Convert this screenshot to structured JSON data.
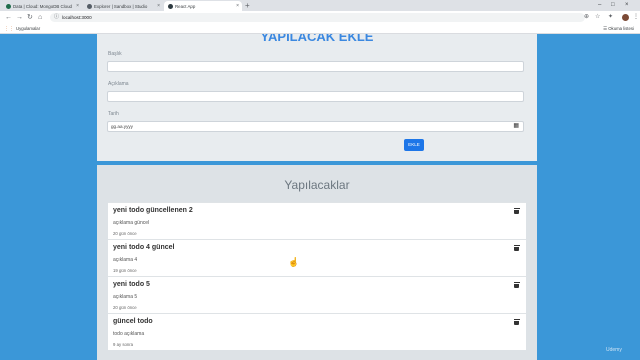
{
  "browser": {
    "tabs": [
      {
        "title": "Data | Cloud: MongoDB Cloud",
        "favicon_color": "#1e6b4a"
      },
      {
        "title": "Explorer | Sandbox | Studio",
        "favicon_color": "#555d66"
      },
      {
        "title": "React App",
        "favicon_color": "#2d3a40"
      }
    ],
    "url": "localhost:3000",
    "bookmarks": {
      "apps_label": "Uygulamalar",
      "reading_list_label": "Okuma listesi"
    }
  },
  "add_form": {
    "title": "YAPILACAK EKLE",
    "title_label": "Başlık",
    "title_value": "",
    "description_label": "Açıklama",
    "description_value": "",
    "date_label": "Tarih",
    "date_placeholder": "gg.aa.yyyy",
    "submit_label": "EKLE"
  },
  "todo_list": {
    "title": "Yapılacaklar",
    "items": [
      {
        "title": "yeni todo güncellenen 2",
        "description": "açıklama güncel",
        "date": "20 gün önce"
      },
      {
        "title": "yeni todo 4 güncel",
        "description": "açıklama 4",
        "date": "19 gün önce"
      },
      {
        "title": "yeni todo 5",
        "description": "açıklama 5",
        "date": "20 gün önce"
      },
      {
        "title": "güncel todo",
        "description": "todo açıklama",
        "date": "9 ay sonra"
      }
    ]
  },
  "watermark": "Udemy",
  "colors": {
    "page_bg": "#3b97d8",
    "accent": "#1d76e8",
    "title_blue": "#3b88e0"
  }
}
